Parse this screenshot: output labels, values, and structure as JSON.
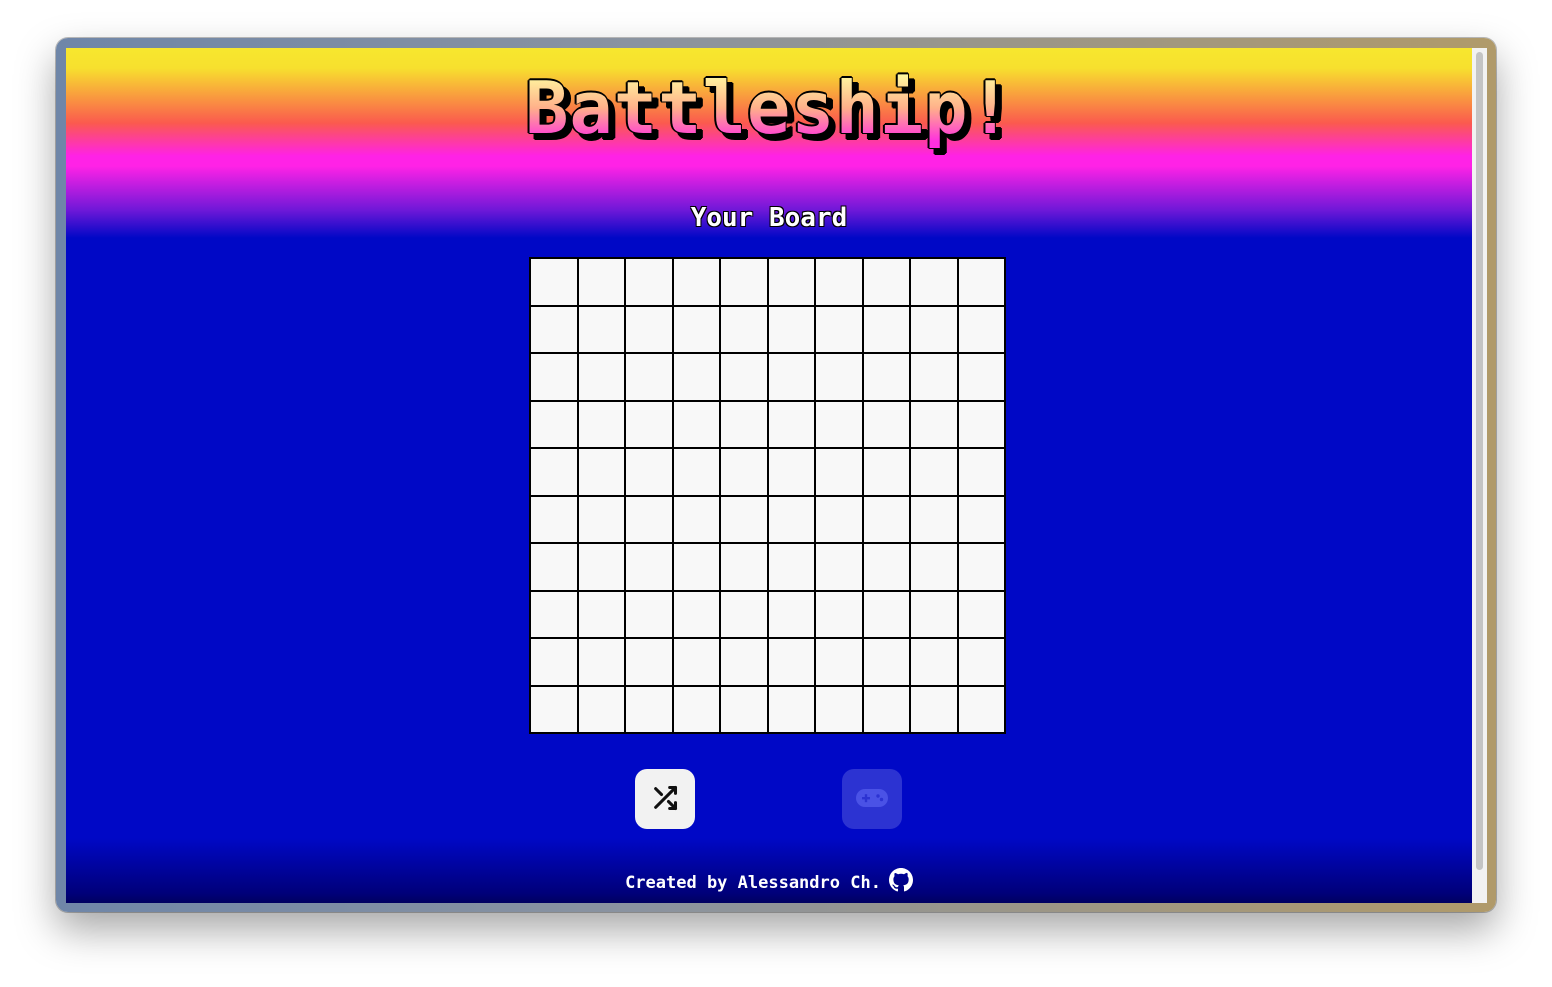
{
  "header": {
    "title": "Battleship!"
  },
  "board": {
    "heading": "Your Board",
    "rows": 10,
    "columns": 10
  },
  "controls": {
    "shuffle_icon": "shuffle-icon",
    "play_icon": "gamepad-icon",
    "play_enabled": false
  },
  "footer": {
    "credit": "Created by Alessandro Ch.",
    "link_icon": "github-icon"
  },
  "colors": {
    "background_blue": "#0008c6",
    "gradient_yellow": "#f7e72e",
    "gradient_magenta": "#ff22e6",
    "cell": "#f8f8f8",
    "grid_lines": "#000000"
  }
}
